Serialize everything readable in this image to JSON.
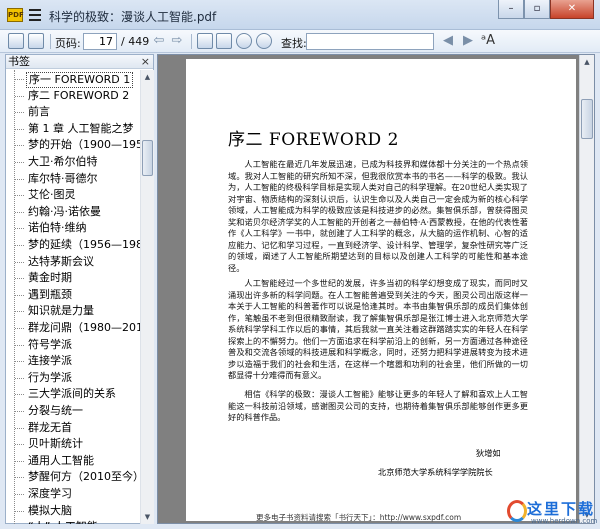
{
  "window": {
    "title": "科学的极致：漫谈人工智能.pdf",
    "minimize": "–",
    "restore": "▫",
    "close": "✕"
  },
  "toolbar": {
    "page_label": "页码:",
    "page_value": "17",
    "page_total": "/ 449",
    "find_label": "查找:",
    "find_value": "",
    "prev_arrow": "◀",
    "next_arrow": "▶",
    "back_arrow": "⇦",
    "forward_arrow": "⇨",
    "font_icon": "ᵃA"
  },
  "sidebar": {
    "title": "书签",
    "close": "×",
    "items": [
      "序一 FOREWORD 1",
      "序二 FOREWORD 2",
      "前言",
      "第 1 章 人工智能之梦",
      "梦的开始（1900—1956）",
      "大卫·希尔伯特",
      "库尔特·哥德尔",
      "艾伦·图灵",
      "约翰·冯·诺依曼",
      "诺伯特·维纳",
      "梦的延续（1956—1980）",
      "达特茅斯会议",
      "黄金时期",
      "遇到瓶颈",
      "知识就是力量",
      "群龙问鼎（1980—2010）",
      "符号学派",
      "连接学派",
      "行为学派",
      "三大学派间的关系",
      "分裂与统一",
      "群龙无首",
      "贝叶斯统计",
      "通用人工智能",
      "梦醒何方（2010至今）",
      "深度学习",
      "模拟大脑",
      "“人” 人工智能"
    ]
  },
  "document": {
    "heading": "序二 FOREWORD 2",
    "paragraphs": [
      "人工智能在最近几年发展迅速，已成为科技界和媒体都十分关注的一个热点领域。我对人工智能的研究所知不深，但我很欣赏本书的书名——科学的极致。我认为，人工智能的终极科学目标是实现人类对自己的科学理解。在20世纪人类实现了对宇宙、物质结构的深刻认识后，认识生命以及人类自己一定会成为新的核心科学领域，人工智能成为科学的极致应该是科技进步的必然。集智俱乐部，曾获得图灵奖和诺贝尔经济学奖的人工智能的开创者之一赫伯特·A·西蒙教授，在他的代表性著作《人工科学》一书中，就创建了人工科学的概念，从大脑的运作机制、心智的适应能力、记忆和学习过程，一直到经济学、设计科学、管理学，复杂性研究等广泛的领域，阐述了人工智能所期望达到的目标以及创建人工科学的可能性和基本途径。",
      "人工智能经过一个多世纪的发展，许多当初的科学幻想变成了现实，而同时又涌现出许多新的科学问题。在人工智能普遍受到关注的今天，图灵公司出版这样一本关于人工智能的科普著作可以说是恰逢其时。本书由集智俱乐部的成员们集体创作，笔触虽不老到但很精致耐读，我了解集智俱乐部是张江博士进入北京师范大学系统科学学科工作以后的事情，其后我就一直关注着这群踏踏实实的年轻人在科学探索上的不懈努力。他们一方面追求在科学前沿上的创新，另一方面通过各种途径普及和交流各领域的科技进展和科学概念，同时，还努力把科学进展转变为技术进步以造福于我们的社会和生活，在这样一个喧嚣和功利的社会里，他们所做的一切都显得十分难得而有意义。",
      "相信《科学的极致：漫谈人工智能》能够让更多的年轻人了解和喜欢上人工智能这一科技前沿领域，感谢图灵公司的支持，也期待着集智俱乐部能够创作更多更好的科普作品。"
    ],
    "signature_name": "狄增如",
    "signature_affiliation": "北京师范大学系统科学学院院长",
    "footer": "更多电子书资料请搜索「书行天下」：http://www.sxpdf.com"
  },
  "watermark": {
    "text": "这里下载",
    "url": "www.herdown.com"
  },
  "colors": {
    "title_bar": "#c6d7ec",
    "viewer_bg": "#808080",
    "watermark_blue": "#1d6ed8"
  }
}
